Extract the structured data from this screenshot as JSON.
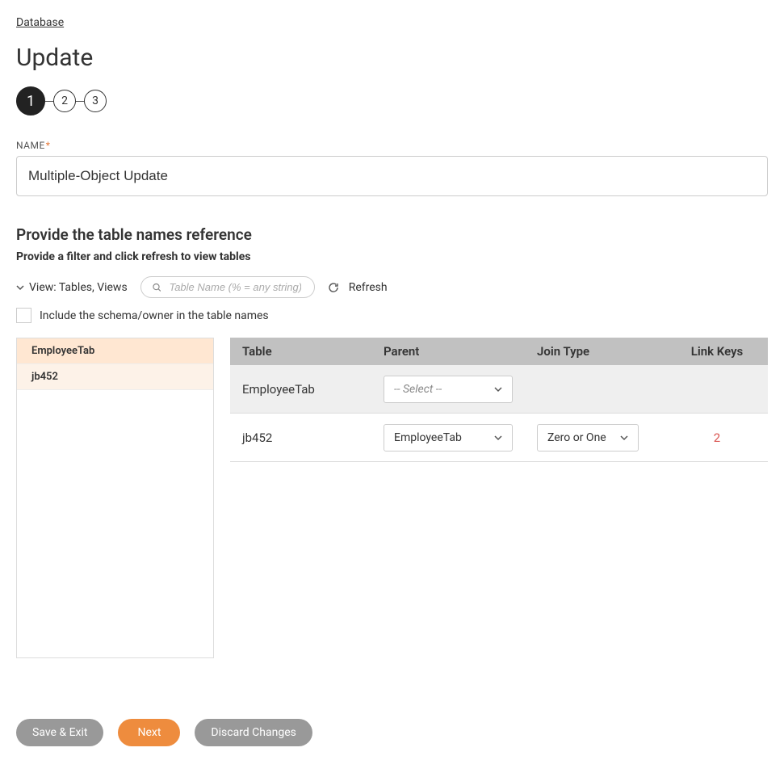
{
  "breadcrumb": {
    "label": "Database"
  },
  "page": {
    "title": "Update"
  },
  "stepper": {
    "steps": [
      "1",
      "2",
      "3"
    ],
    "active": 0
  },
  "nameField": {
    "label": "NAME",
    "required": "*",
    "value": "Multiple-Object Update"
  },
  "section": {
    "title": "Provide the table names reference",
    "subtitle": "Provide a filter and click refresh to view tables"
  },
  "filter": {
    "view_label": "View: Tables, Views",
    "search_placeholder": "Table Name (% = any string)",
    "refresh_label": "Refresh"
  },
  "schemaCheckbox": {
    "label": "Include the schema/owner in the table names",
    "checked": false
  },
  "tableList": [
    {
      "name": "EmployeeTab",
      "style": "highlight-dark"
    },
    {
      "name": "jb452",
      "style": "highlight-light"
    }
  ],
  "configHeader": {
    "table": "Table",
    "parent": "Parent",
    "join": "Join Type",
    "link": "Link Keys"
  },
  "configRows": [
    {
      "table": "EmployeeTab",
      "parent": "-- Select --",
      "parent_placeholder": true,
      "join": "",
      "link": "",
      "alt": true
    },
    {
      "table": "jb452",
      "parent": "EmployeeTab",
      "parent_placeholder": false,
      "join": "Zero or One",
      "link": "2",
      "alt": false
    }
  ],
  "buttons": {
    "save": "Save & Exit",
    "next": "Next",
    "discard": "Discard Changes"
  }
}
